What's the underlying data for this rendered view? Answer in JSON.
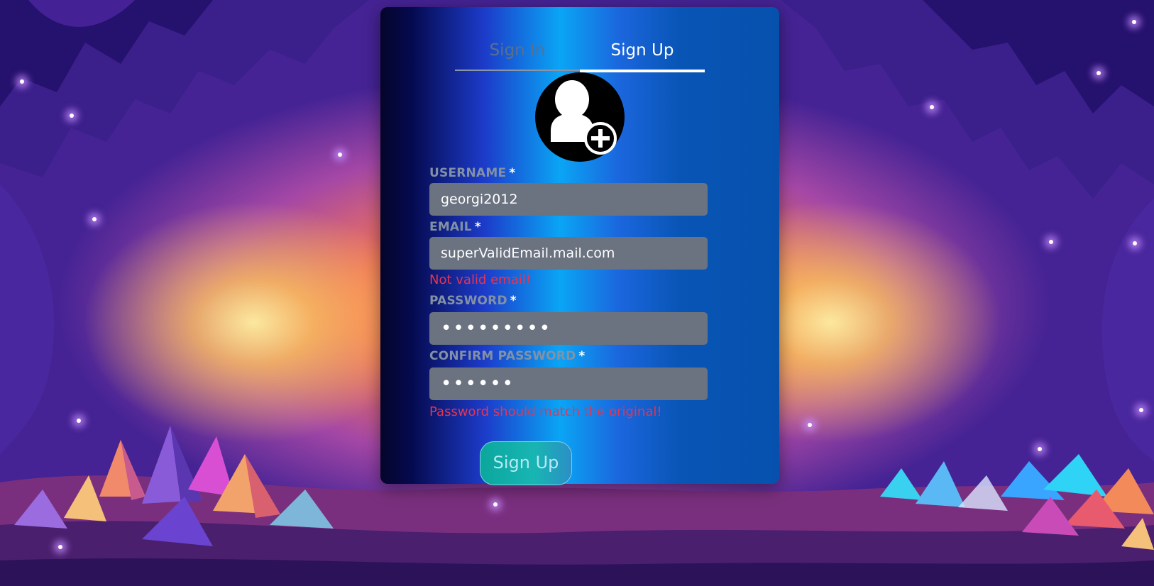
{
  "auth_tabs": {
    "sign_in_label": "Sign In",
    "sign_up_label": "Sign Up",
    "active": "Sign Up"
  },
  "avatar": {
    "icon": "add-user-icon"
  },
  "form": {
    "username": {
      "label": "USERNAME",
      "required_mark": "*",
      "value": "georgi2012"
    },
    "email": {
      "label": "EMAIL",
      "required_mark": "*",
      "value": "superValidEmail.mail.com",
      "error": "Not valid email!"
    },
    "password": {
      "label": "PASSWORD",
      "required_mark": "*",
      "value": "•••••••••"
    },
    "confirm_password": {
      "label": "CONFIRM PASSWORD",
      "required_mark": "*",
      "value": "••••••",
      "error": "Password should match the original!"
    },
    "submit_label": "Sign Up"
  },
  "colors": {
    "error": "#e8344f",
    "input_background": "#6b7280",
    "label": "#8391a6",
    "submit_gradient_start": "#0ba79e"
  }
}
